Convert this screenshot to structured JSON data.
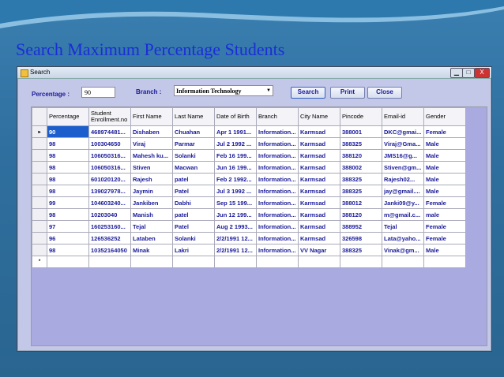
{
  "slide": {
    "title": "Search Maximum Percentage Students"
  },
  "window": {
    "title": "Search",
    "min_label": "",
    "max_label": "",
    "close_label": "X"
  },
  "form": {
    "percentage_label": "Percentage :",
    "percentage_value": "90",
    "branch_label": "Branch :",
    "branch_value": "Information Technology",
    "search_label": "Search",
    "print_label": "Print",
    "close_label": "Close"
  },
  "grid": {
    "headers": [
      "Percentage",
      "Student Enrollment.no",
      "First Name",
      "Last Name",
      "Date of Birth",
      "Branch",
      "City Name",
      "Pincode",
      "Email-id",
      "Gender"
    ],
    "rows": [
      [
        "90",
        "468974481...",
        "Dishaben",
        "Chuahan",
        "Apr 1 1991...",
        "Information...",
        "Karmsad",
        "388001",
        "DKC@gmai...",
        "Female"
      ],
      [
        "98",
        "100304650",
        "Viraj",
        "Parmar",
        "Jul 2 1992 ...",
        "Information...",
        "Karmsad",
        "388325",
        "Viraj@Gma...",
        "Male"
      ],
      [
        "98",
        "106050316...",
        "Mahesh ku...",
        "Solanki",
        "Feb 16 199...",
        "Information...",
        "Karmsad",
        "388120",
        "JMS16@g...",
        "Male"
      ],
      [
        "98",
        "106050316...",
        "Stiven",
        "Macwan",
        "Jun 16 199...",
        "Information...",
        "Karmsad",
        "388002",
        "Stiven@gm...",
        "Male"
      ],
      [
        "98",
        "601020120...",
        "Rajesh",
        "patel",
        "Feb 2 1992...",
        "Information...",
        "Karmsad",
        "388325",
        "Rajesh02...",
        "Male"
      ],
      [
        "98",
        "139027978...",
        "Jaymin",
        "Patel",
        "Jul 3 1992 ...",
        "Information...",
        "Karmsad",
        "388325",
        "jay@gmail....",
        "Male"
      ],
      [
        "99",
        "104603240...",
        "Jankiben",
        "Dabhi",
        "Sep 15 199...",
        "Information...",
        "Karmsad",
        "388012",
        "Janki09@y...",
        "Female"
      ],
      [
        "98",
        "10203040",
        "Manish",
        "patel",
        "Jun 12 199...",
        "Information...",
        "Karmsad",
        "388120",
        "m@gmail.c...",
        "male"
      ],
      [
        "97",
        "160253160...",
        "Tejal",
        "Patel",
        "Aug 2 1993...",
        "Information...",
        "Karmsad",
        "388952",
        "Tejal",
        "Female"
      ],
      [
        "96",
        "126536252",
        "Lataben",
        "Solanki",
        "2/2/1991 12...",
        "Information...",
        "Karmsad",
        "326598",
        "Lata@yaho...",
        "Female"
      ],
      [
        "98",
        "10352164050",
        "Minak",
        "Lakri",
        "2/2/1991 12...",
        "Information...",
        "VV Nagar",
        "388325",
        "Vinak@gm...",
        "Male"
      ]
    ],
    "current_row_marker": "▸",
    "new_row_marker": "*"
  }
}
